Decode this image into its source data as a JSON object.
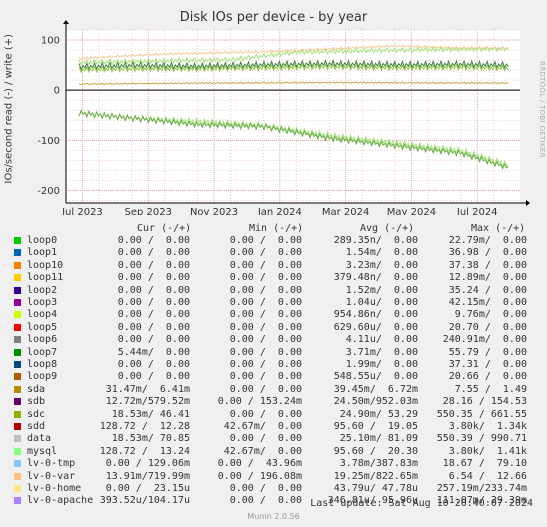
{
  "chart_data": {
    "type": "line",
    "title": "Disk IOs per device - by year",
    "ylabel": "IOs/second read (-) / write (+)",
    "ylim": [
      -225,
      120
    ],
    "y_ticks": [
      100,
      0,
      -100,
      -200
    ],
    "y_tick_labels": [
      "100",
      "0",
      "-100",
      "-200"
    ],
    "x_tick_labels": [
      "Jul 2023",
      "Sep 2023",
      "Nov 2023",
      "Jan 2024",
      "Mar 2024",
      "May 2024",
      "Jul 2024"
    ],
    "x_range_months": [
      0,
      13.8
    ],
    "x_ticks_months": [
      0.5,
      2.5,
      4.5,
      6.5,
      8.5,
      10.5,
      12.5
    ],
    "grid": true,
    "curves": [
      {
        "name": "sdb write",
        "color": "#3f7f3f",
        "points": [
          [
            0.4,
            46
          ],
          [
            2,
            49
          ],
          [
            4,
            47
          ],
          [
            6,
            50
          ],
          [
            8,
            52
          ],
          [
            10,
            50
          ],
          [
            12,
            51
          ],
          [
            13.5,
            49
          ]
        ],
        "amp": 14
      },
      {
        "name": "sdc write",
        "color": "#8fc63f",
        "points": [
          [
            0.4,
            40
          ],
          [
            2,
            42
          ],
          [
            4,
            42
          ],
          [
            6,
            44
          ],
          [
            8,
            46
          ],
          [
            10,
            44
          ],
          [
            12,
            45
          ],
          [
            13.5,
            43
          ]
        ],
        "amp": 12
      },
      {
        "name": "mysql write",
        "color": "#a3e37a",
        "points": [
          [
            0.4,
            55
          ],
          [
            3,
            58
          ],
          [
            5,
            60
          ],
          [
            7,
            75
          ],
          [
            9,
            78
          ],
          [
            11,
            80
          ],
          [
            13.5,
            82
          ]
        ],
        "amp": 10
      },
      {
        "name": "sda write",
        "color": "#c9a648",
        "points": [
          [
            0.4,
            12
          ],
          [
            4,
            14
          ],
          [
            8,
            15
          ],
          [
            13.5,
            14
          ]
        ],
        "amp": 3
      },
      {
        "name": "lv-0-var write",
        "color": "#f5c995",
        "points": [
          [
            0.4,
            63
          ],
          [
            3,
            72
          ],
          [
            6,
            76
          ],
          [
            8,
            82
          ],
          [
            10,
            88
          ],
          [
            12,
            84
          ],
          [
            13.5,
            84
          ]
        ],
        "amp": 5
      },
      {
        "name": "sdd read",
        "color": "#a3e37a",
        "points": [
          [
            0.4,
            -45
          ],
          [
            2,
            -55
          ],
          [
            4,
            -62
          ],
          [
            6,
            -70
          ],
          [
            8,
            -90
          ],
          [
            10,
            -105
          ],
          [
            12,
            -120
          ],
          [
            13.5,
            -150
          ]
        ],
        "amp": 15
      },
      {
        "name": "data read",
        "color": "#6aaa4a",
        "points": [
          [
            0.4,
            -45
          ],
          [
            2,
            -55
          ],
          [
            4,
            -68
          ],
          [
            6,
            -72
          ],
          [
            8,
            -95
          ],
          [
            10,
            -110
          ],
          [
            12,
            -125
          ],
          [
            13.5,
            -155
          ]
        ],
        "amp": 12
      }
    ],
    "series_table": {
      "columns": [
        "Cur (-/+)",
        "Min (-/+)",
        "Avg (-/+)",
        "Max (-/+)"
      ],
      "rows": [
        {
          "name": "loop0",
          "color": "#00cc00",
          "cur": "0.00 /  0.00",
          "min": "0.00 /  0.00",
          "avg": "289.35n/  0.00",
          "max": "22.79m/  0.00"
        },
        {
          "name": "loop1",
          "color": "#0066b3",
          "cur": "0.00 /  0.00",
          "min": "0.00 /  0.00",
          "avg": "1.54m/  0.00",
          "max": "36.98 /  0.00"
        },
        {
          "name": "loop10",
          "color": "#ff8000",
          "cur": "0.00 /  0.00",
          "min": "0.00 /  0.00",
          "avg": "3.23m/  0.00",
          "max": "37.38 /  0.00"
        },
        {
          "name": "loop11",
          "color": "#ffcc00",
          "cur": "0.00 /  0.00",
          "min": "0.00 /  0.00",
          "avg": "379.48n/  0.00",
          "max": "12.89m/  0.00"
        },
        {
          "name": "loop2",
          "color": "#330099",
          "cur": "0.00 /  0.00",
          "min": "0.00 /  0.00",
          "avg": "1.52m/  0.00",
          "max": "35.24 /  0.00"
        },
        {
          "name": "loop3",
          "color": "#990099",
          "cur": "0.00 /  0.00",
          "min": "0.00 /  0.00",
          "avg": "1.04u/  0.00",
          "max": "42.15m/  0.00"
        },
        {
          "name": "loop4",
          "color": "#ccff00",
          "cur": "0.00 /  0.00",
          "min": "0.00 /  0.00",
          "avg": "954.86n/  0.00",
          "max": "9.76m/  0.00"
        },
        {
          "name": "loop5",
          "color": "#ff0000",
          "cur": "0.00 /  0.00",
          "min": "0.00 /  0.00",
          "avg": "629.60u/  0.00",
          "max": "20.70 /  0.00"
        },
        {
          "name": "loop6",
          "color": "#808080",
          "cur": "0.00 /  0.00",
          "min": "0.00 /  0.00",
          "avg": "4.11u/  0.00",
          "max": "240.91m/  0.00"
        },
        {
          "name": "loop7",
          "color": "#008f00",
          "cur": "5.44m/  0.00",
          "min": "0.00 /  0.00",
          "avg": "3.71m/  0.00",
          "max": "55.79 /  0.00"
        },
        {
          "name": "loop8",
          "color": "#00487d",
          "cur": "0.00 /  0.00",
          "min": "0.00 /  0.00",
          "avg": "1.99m/  0.00",
          "max": "37.31 /  0.00"
        },
        {
          "name": "loop9",
          "color": "#b35a00",
          "cur": "0.00 /  0.00",
          "min": "0.00 /  0.00",
          "avg": "548.55u/  0.00",
          "max": "20.66 /  0.00"
        },
        {
          "name": "sda",
          "color": "#b38f00",
          "cur": "31.47m/  6.41m",
          "min": "0.00 /  0.00",
          "avg": "39.45m/  6.72m",
          "max": "7.55 /  1.49"
        },
        {
          "name": "sdb",
          "color": "#6b006b",
          "cur": "12.72m/579.52m",
          "min": "0.00 / 153.24m",
          "avg": "24.50m/952.03m",
          "max": "28.16 / 154.53"
        },
        {
          "name": "sdc",
          "color": "#8fb300",
          "cur": "18.53m/ 46.41",
          "min": "0.00 /  0.00",
          "avg": "24.90m/ 53.29",
          "max": "550.35 / 661.55"
        },
        {
          "name": "sdd",
          "color": "#b30000",
          "cur": "128.72 /  12.28",
          "min": "42.67m/  0.00",
          "avg": "95.60 /  19.05",
          "max": "3.80k/  1.34k"
        },
        {
          "name": "data",
          "color": "#bebebe",
          "cur": "18.53m/ 70.85",
          "min": "0.00 /  0.00",
          "avg": "25.10m/ 81.09",
          "max": "550.39 / 990.71"
        },
        {
          "name": "mysql",
          "color": "#80ff80",
          "cur": "128.72 /  13.24",
          "min": "42.67m/  0.00",
          "avg": "95.60 /  20.30",
          "max": "3.80k/  1.41k"
        },
        {
          "name": "lv-0-tmp",
          "color": "#80c9ff",
          "cur": "0.00 / 129.06m",
          "min": "0.00 /  43.96m",
          "avg": "3.78m/387.83m",
          "max": "18.67 /  79.10"
        },
        {
          "name": "lv-0-var",
          "color": "#ffc080",
          "cur": "13.91m/719.99m",
          "min": "0.00 / 196.08m",
          "avg": "19.25m/822.65m",
          "max": "6.54 /  12.66"
        },
        {
          "name": "lv-0-home",
          "color": "#ffe680",
          "cur": "0.00 /  23.15u",
          "min": "0.00 /  0.00",
          "avg": "43.79u/ 47.78u",
          "max": "257.19m/233.74m"
        },
        {
          "name": "lv-0-apache",
          "color": "#aa80ff",
          "cur": "393.52u/104.17u",
          "min": "0.00 /  0.00",
          "avg": "346.81u/ 95.96u",
          "max": "111.07m/ 29.39m"
        }
      ]
    }
  },
  "watermark": "RRDTOOL / TOBI OETIKER",
  "last_update": "Last update: Sat Aug 10 20:40:07 2024",
  "munin_version": "Munin 2.0.56"
}
